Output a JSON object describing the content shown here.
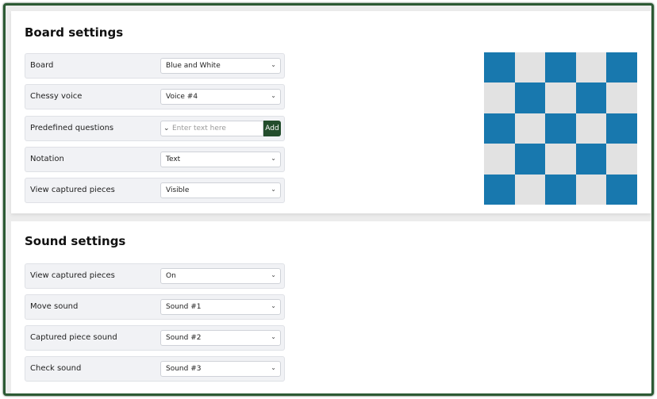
{
  "board_settings": {
    "title": "Board settings",
    "rows": [
      {
        "label": "Board",
        "value": "Blue and White"
      },
      {
        "label": "Chessy voice",
        "value": "Voice #4"
      },
      {
        "label": "Predefined questions",
        "placeholder": "Enter text here",
        "button": "Add"
      },
      {
        "label": "Notation",
        "value": "Text"
      },
      {
        "label": "View captured pieces",
        "value": "Visible"
      }
    ],
    "preview": {
      "dark_color": "#1878ae",
      "light_color": "#e2e2e2",
      "pattern": [
        [
          1,
          0,
          1,
          0,
          1
        ],
        [
          0,
          1,
          0,
          1,
          0
        ],
        [
          1,
          0,
          1,
          0,
          1
        ],
        [
          0,
          1,
          0,
          1,
          0
        ],
        [
          1,
          0,
          1,
          0,
          1
        ]
      ]
    }
  },
  "sound_settings": {
    "title": "Sound settings",
    "rows": [
      {
        "label": "View captured pieces",
        "value": "On"
      },
      {
        "label": "Move sound",
        "value": "Sound #1"
      },
      {
        "label": "Captured piece sound",
        "value": "Sound #2"
      },
      {
        "label": "Check sound",
        "value": "Sound #3"
      }
    ]
  },
  "icons": {
    "select_chevron": "chevron-down-icon",
    "input_chevron": "chevron-down-icon"
  }
}
